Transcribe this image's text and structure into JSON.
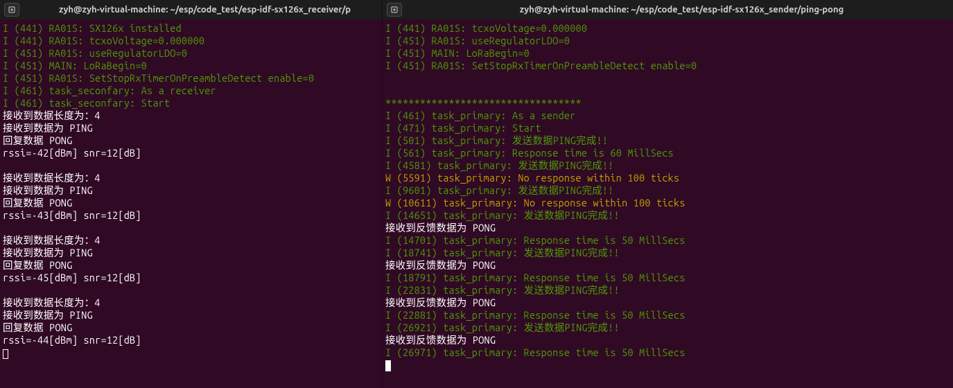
{
  "left": {
    "title": "zyh@zyh-virtual-machine: ~/esp/code_test/esp-idf-sx126x_receiver/p",
    "lines": [
      {
        "cls": "c-info",
        "text": "I (441) RA01S: SX126x installed"
      },
      {
        "cls": "c-info",
        "text": "I (441) RA01S: tcxoVoltage=0.000000"
      },
      {
        "cls": "c-info",
        "text": "I (451) RA01S: useRegulatorLDO=0"
      },
      {
        "cls": "c-info",
        "text": "I (451) MAIN: LoRaBegin=0"
      },
      {
        "cls": "c-info",
        "text": "I (451) RA01S: SetStopRxTimerOnPreambleDetect enable=0"
      },
      {
        "cls": "c-info",
        "text": "I (461) task_seconfary: As a receiver"
      },
      {
        "cls": "c-info",
        "text": "I (461) task_seconfary: Start"
      },
      {
        "cls": "c-plain",
        "text": "接收到数据长度为：4"
      },
      {
        "cls": "c-plain",
        "text": "接收到数据为 PING"
      },
      {
        "cls": "c-plain",
        "text": "回复数据 PONG"
      },
      {
        "cls": "c-plain",
        "text": "rssi=-42[dBm] snr=12[dB]"
      },
      {
        "cls": "blank",
        "text": ""
      },
      {
        "cls": "c-plain",
        "text": "接收到数据长度为：4"
      },
      {
        "cls": "c-plain",
        "text": "接收到数据为 PING"
      },
      {
        "cls": "c-plain",
        "text": "回复数据 PONG"
      },
      {
        "cls": "c-plain",
        "text": "rssi=-43[dBm] snr=12[dB]"
      },
      {
        "cls": "blank",
        "text": ""
      },
      {
        "cls": "c-plain",
        "text": "接收到数据长度为：4"
      },
      {
        "cls": "c-plain",
        "text": "接收到数据为 PING"
      },
      {
        "cls": "c-plain",
        "text": "回复数据 PONG"
      },
      {
        "cls": "c-plain",
        "text": "rssi=-45[dBm] snr=12[dB]"
      },
      {
        "cls": "blank",
        "text": ""
      },
      {
        "cls": "c-plain",
        "text": "接收到数据长度为：4"
      },
      {
        "cls": "c-plain",
        "text": "接收到数据为 PING"
      },
      {
        "cls": "c-plain",
        "text": "回复数据 PONG"
      },
      {
        "cls": "c-plain",
        "text": "rssi=-44[dBm] snr=12[dB]"
      }
    ]
  },
  "right": {
    "title": "zyh@zyh-virtual-machine: ~/esp/code_test/esp-idf-sx126x_sender/ping-pong",
    "lines": [
      {
        "cls": "c-info",
        "text": "I (441) RA01S: tcxoVoltage=0.000000"
      },
      {
        "cls": "c-info",
        "text": "I (451) RA01S: useRegulatorLDO=0"
      },
      {
        "cls": "c-info",
        "text": "I (451) MAIN: LoRaBegin=0"
      },
      {
        "cls": "c-info",
        "text": "I (451) RA01S: SetStopRxTimerOnPreambleDetect enable=0"
      },
      {
        "cls": "blank",
        "text": ""
      },
      {
        "cls": "blank",
        "text": ""
      },
      {
        "cls": "c-stars",
        "text": "**********************************"
      },
      {
        "cls": "c-info",
        "text": "I (461) task_primary: As a sender"
      },
      {
        "cls": "c-info",
        "text": "I (471) task_primary: Start"
      },
      {
        "cls": "c-info",
        "text": "I (501) task_primary: 发送数据PING完成!!"
      },
      {
        "cls": "c-info",
        "text": "I (561) task_primary: Response time is 60 MillSecs"
      },
      {
        "cls": "c-info",
        "text": "I (4581) task_primary: 发送数据PING完成!!"
      },
      {
        "cls": "c-warn",
        "text": "W (5591) task_primary: No response within 100 ticks"
      },
      {
        "cls": "c-info",
        "text": "I (9601) task_primary: 发送数据PING完成!!"
      },
      {
        "cls": "c-warn",
        "text": "W (10611) task_primary: No response within 100 ticks"
      },
      {
        "cls": "c-info",
        "text": "I (14651) task_primary: 发送数据PING完成!!"
      },
      {
        "cls": "c-plain",
        "text": "接收到反馈数据为 PONG"
      },
      {
        "cls": "c-info",
        "text": "I (14701) task_primary: Response time is 50 MillSecs"
      },
      {
        "cls": "c-info",
        "text": "I (18741) task_primary: 发送数据PING完成!!"
      },
      {
        "cls": "c-plain",
        "text": "接收到反馈数据为 PONG"
      },
      {
        "cls": "c-info",
        "text": "I (18791) task_primary: Response time is 50 MillSecs"
      },
      {
        "cls": "c-info",
        "text": "I (22831) task_primary: 发送数据PING完成!!"
      },
      {
        "cls": "c-plain",
        "text": "接收到反馈数据为 PONG"
      },
      {
        "cls": "c-info",
        "text": "I (22881) task_primary: Response time is 50 MillSecs"
      },
      {
        "cls": "c-info",
        "text": "I (26921) task_primary: 发送数据PING完成!!"
      },
      {
        "cls": "c-plain",
        "text": "接收到反馈数据为 PONG"
      },
      {
        "cls": "c-info",
        "text": "I (26971) task_primary: Response time is 50 MillSecs"
      }
    ]
  }
}
